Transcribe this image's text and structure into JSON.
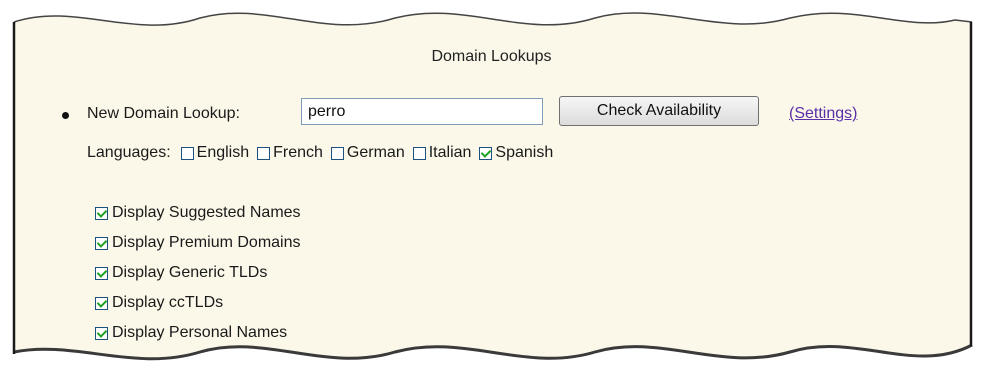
{
  "panel": {
    "title": "Domain Lookups",
    "lookup": {
      "label": "New Domain Lookup:",
      "value": "perro",
      "button_label": "Check Availability",
      "settings_link": "(Settings)"
    },
    "languages": {
      "label": "Languages:",
      "options": [
        {
          "label": "English",
          "checked": false
        },
        {
          "label": "French",
          "checked": false
        },
        {
          "label": "German",
          "checked": false
        },
        {
          "label": "Italian",
          "checked": false
        },
        {
          "label": "Spanish",
          "checked": true
        }
      ]
    },
    "display_options": [
      {
        "label": "Display Suggested Names",
        "checked": true
      },
      {
        "label": "Display Premium Domains",
        "checked": true
      },
      {
        "label": "Display Generic TLDs",
        "checked": true
      },
      {
        "label": "Display ccTLDs",
        "checked": true
      },
      {
        "label": "Display Personal Names",
        "checked": true
      }
    ]
  },
  "colors": {
    "panel_background": "#fbf8ea",
    "panel_border": "#1a1a1a",
    "link": "#5b2fa6",
    "check_mark": "#21a121"
  }
}
